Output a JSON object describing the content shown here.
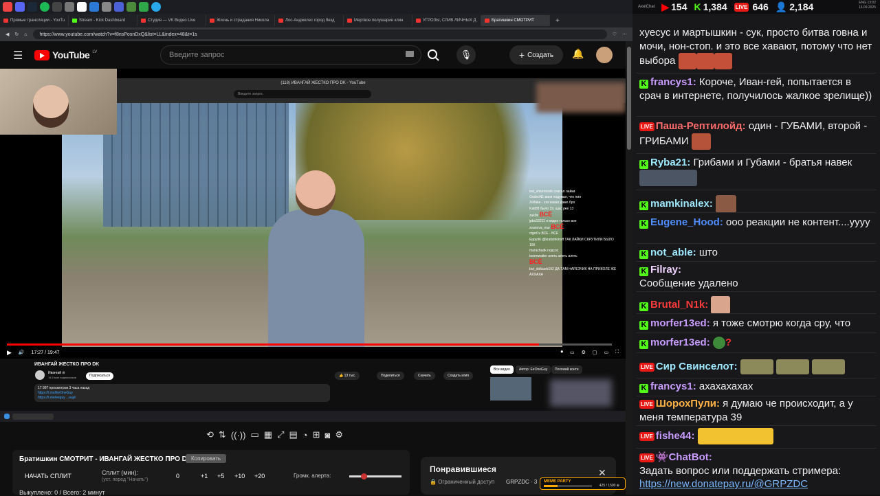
{
  "browser": {
    "tabs": [
      {
        "label": "Прямые трансляции - YouTu"
      },
      {
        "label": "Stream - Kick Dashboard"
      },
      {
        "label": "Студия — VK Видео Live"
      },
      {
        "label": "Жизнь и страдания Никола"
      },
      {
        "label": "Лос-Анджелес город безд"
      },
      {
        "label": "Мертвое полушарие клин"
      },
      {
        "label": "УГРОЗЫ, СЛИВ ЛИЧНЫХ Д"
      },
      {
        "label": "Братишкин СМОТРИТ"
      }
    ],
    "url": "https://www.youtube.com/watch?v=f8nsPosnDxQ&list=LL&index=48&t=1s"
  },
  "youtube": {
    "logo_text": "YouTube",
    "logo_region": "LV",
    "search_placeholder": "Введите запрос",
    "create_label": "Создать",
    "video": {
      "inner_title": "(118) ИВАНГАЙ ЖЕСТКО ПРО DK - YouTube",
      "inner_search": "Введите запрос",
      "time": "17:27 / 19:47",
      "progress": 0.88,
      "title": "ИВАНГАЙ ЖЕСТКО ПРО DK",
      "channel": "Ивангай ⊘",
      "subscribers": "14,5 млн подписчиков",
      "subscribe_label": "Подписаться",
      "likes": "👍 13 тыс.",
      "share": "Поделиться",
      "download": "Скачать",
      "clip": "Создать клип",
      "desc_line1": "17 997 просмотров  3 часа назад",
      "desc_line2": "https://t.me/EeOneGuy",
      "desc_line3": "https://t.me/eeguy  ...ещё",
      "chip_all": "Все видео",
      "chip_author": "Автор: EeOneGuy",
      "chip_similar": "Похожий конте"
    },
    "overlay_chat": [
      "ted_shturmovik списал лайки",
      "GodsoN1 ваня подумал, что лил",
      "Zelfake - это канал даже бро",
      "Katt88 было 19, щас уже 13",
      "zuk9k",
      "jpbs33211 я видео только вое",
      "xvanova_mur",
      "ctget1v ВСЕ - ВСЕ",
      "Eppy96 @kratishkinoff ТАК ЛАЙКИ СКРУТИЛИ БЫЛО 15К",
      "marachadk подсос",
      "boomwaiter алеть алеть алеть",
      "bot_dolbaeb192 ДА ТАМ НАРЕЗЧИК НА ПРИКОЛЕ ЖЕ АХХАХА"
    ],
    "overlay_red": "ВСЁ"
  },
  "overlay_tools": {
    "panel_title": "Братишкин СМОТРИТ - ИВАНГАЙ ЖЕСТКО ПРО DK",
    "copy_label": "Копировать",
    "split_button": "НАЧАТЬ СПЛИТ",
    "split_label": "Сплит (мин):",
    "split_hint": "(уст. перед \"Начать\")",
    "split_value": "0",
    "increments": [
      "+1",
      "+5",
      "+10",
      "+20"
    ],
    "alert_label": "Громк. алерта:",
    "alert_volume": 0.22,
    "bought": "Выкуплено: 0 / Всего: 2 минут"
  },
  "liked_panel": {
    "title": "Понравившиеся",
    "access": "Ограниченный доступ",
    "code": "GRPZDC · 3",
    "meme_title": "MEME PARTY",
    "meme_progress": "425 / 1500 ⊕",
    "meme_fill": 0.28
  },
  "chat": {
    "brand": "AxelChat",
    "stats": {
      "youtube": "154",
      "kick": "1,384",
      "vk": "646",
      "viewers": "2,184"
    },
    "clock": "13:02",
    "date": "16.09.2025",
    "lang": "ENG",
    "messages": [
      {
        "text": "хуесус и мартышкин - сук, просто битва говна и мочи, нон-стоп. и это все хавают, потому что нет выбора"
      },
      {
        "user": "francys1:",
        "text": "Короче, Иван-гей, попытается в срач в интернете, получилось жалкое зрелище))",
        "color": "#c79bff"
      },
      {
        "user": "Паша-Рептилойд:",
        "text": "один - ГУБАМИ, второй - ГРИБАМИ",
        "color": "#ff6b6b"
      },
      {
        "user": "Ryba21:",
        "text": "Грибами и Губами - братья навек",
        "color": "#9ee8ff"
      },
      {
        "user": "mamkinalex:",
        "text": "",
        "color": "#9ee8ff"
      },
      {
        "user": "Eugene_Hood:",
        "text": "ооо реакции не контент....уууу",
        "color": "#4e8cff"
      },
      {
        "user": "not_able:",
        "text": "што",
        "color": "#9ee8ff"
      },
      {
        "user": "Filray:",
        "text": "Сообщение удалено",
        "color": "#f0d4ff"
      },
      {
        "user": "Brutal_N1k:",
        "text": "",
        "color": "#ff3b3b"
      },
      {
        "user": "morfer13ed:",
        "text": "я тоже смотрю когда сру, что",
        "color": "#c79bff"
      },
      {
        "user": "morfer13ed:",
        "text": "",
        "color": "#c79bff"
      },
      {
        "user": "Сир Свинселот:",
        "text": "",
        "color": "#9ee8ff"
      },
      {
        "user": "francys1:",
        "text": "ахахахахах",
        "color": "#c79bff"
      },
      {
        "user": "ШорохПули:",
        "text": "я думаю че происходит, а у меня температура 39",
        "color": "#ffb347"
      },
      {
        "user": "fishe44:",
        "text": "",
        "color": "#c79bff"
      },
      {
        "user": "ChatBot:",
        "text": "Задать вопрос или поддержать стримера:",
        "color": "#c79bff"
      }
    ],
    "donate_link": "https://new.donatepay.ru/@GRPZDC"
  }
}
